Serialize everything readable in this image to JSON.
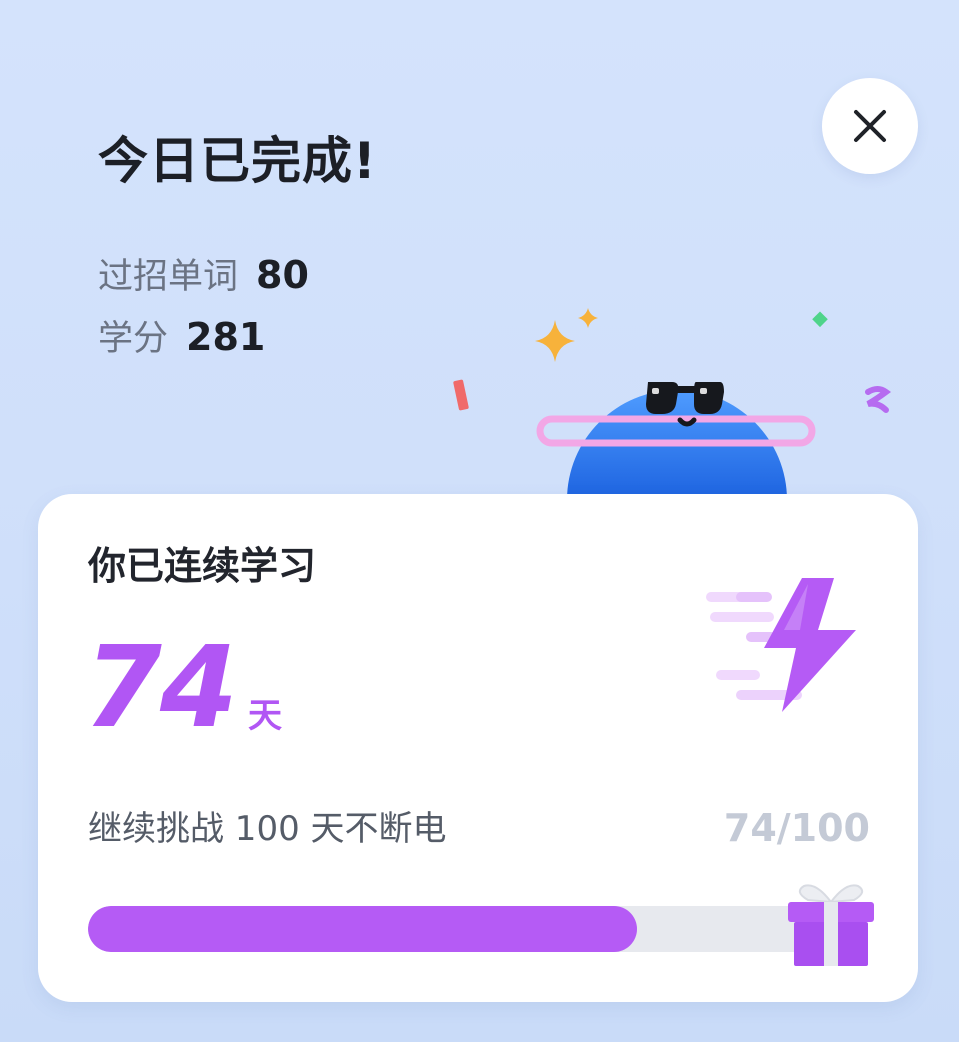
{
  "header": {
    "title": "今日已完成!",
    "close_icon": "close-icon"
  },
  "stats": {
    "words_label": "过招单词",
    "words_value": "80",
    "credits_label": "学分",
    "credits_value": "281"
  },
  "mascot": {
    "icon": "planet-mascot-with-sunglasses",
    "decorations": [
      "sparkle-icon",
      "confetti-icon"
    ]
  },
  "streak": {
    "heading": "你已连续学习",
    "days": "74",
    "unit": "天",
    "icon": "lightning-bolt-icon"
  },
  "challenge": {
    "text": "继续挑战 100 天不断电",
    "progress_text": "74/100",
    "progress_fraction": 0.74,
    "reward_icon": "gift-box-icon"
  },
  "colors": {
    "background": "#d3e2fb",
    "accent_purple": "#b156f4",
    "progress_track": "#e7e9ee",
    "mascot_blue": "#2f7ff0",
    "ring_pink": "#f2a7e6"
  }
}
